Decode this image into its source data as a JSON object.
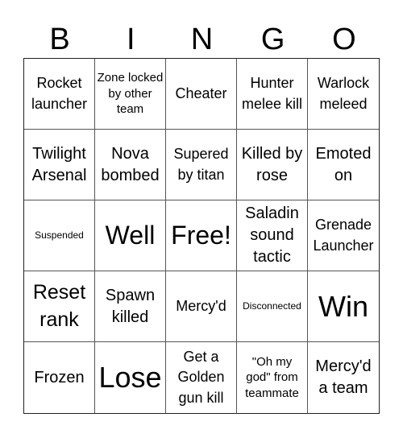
{
  "header": {
    "letters": [
      "B",
      "I",
      "N",
      "G",
      "O"
    ]
  },
  "cells": [
    {
      "text": "Rocket launcher"
    },
    {
      "text": "Zone locked by other team"
    },
    {
      "text": "Cheater"
    },
    {
      "text": "Hunter melee kill"
    },
    {
      "text": "Warlock meleed"
    },
    {
      "text": "Twilight Arsenal"
    },
    {
      "text": "Nova bombed"
    },
    {
      "text": "Supered by titan"
    },
    {
      "text": "Killed by rose"
    },
    {
      "text": "Emoted on"
    },
    {
      "text": "Suspended"
    },
    {
      "text": "Well"
    },
    {
      "text": "Free!"
    },
    {
      "text": "Saladin sound tactic"
    },
    {
      "text": "Grenade Launcher"
    },
    {
      "text": "Reset rank"
    },
    {
      "text": "Spawn killed"
    },
    {
      "text": "Mercy'd"
    },
    {
      "text": "Disconnected"
    },
    {
      "text": "Win"
    },
    {
      "text": "Frozen"
    },
    {
      "text": "Lose"
    },
    {
      "text": "Get a Golden gun kill"
    },
    {
      "text": "\"Oh my god\" from teammate"
    },
    {
      "text": "Mercy'd a team"
    }
  ]
}
